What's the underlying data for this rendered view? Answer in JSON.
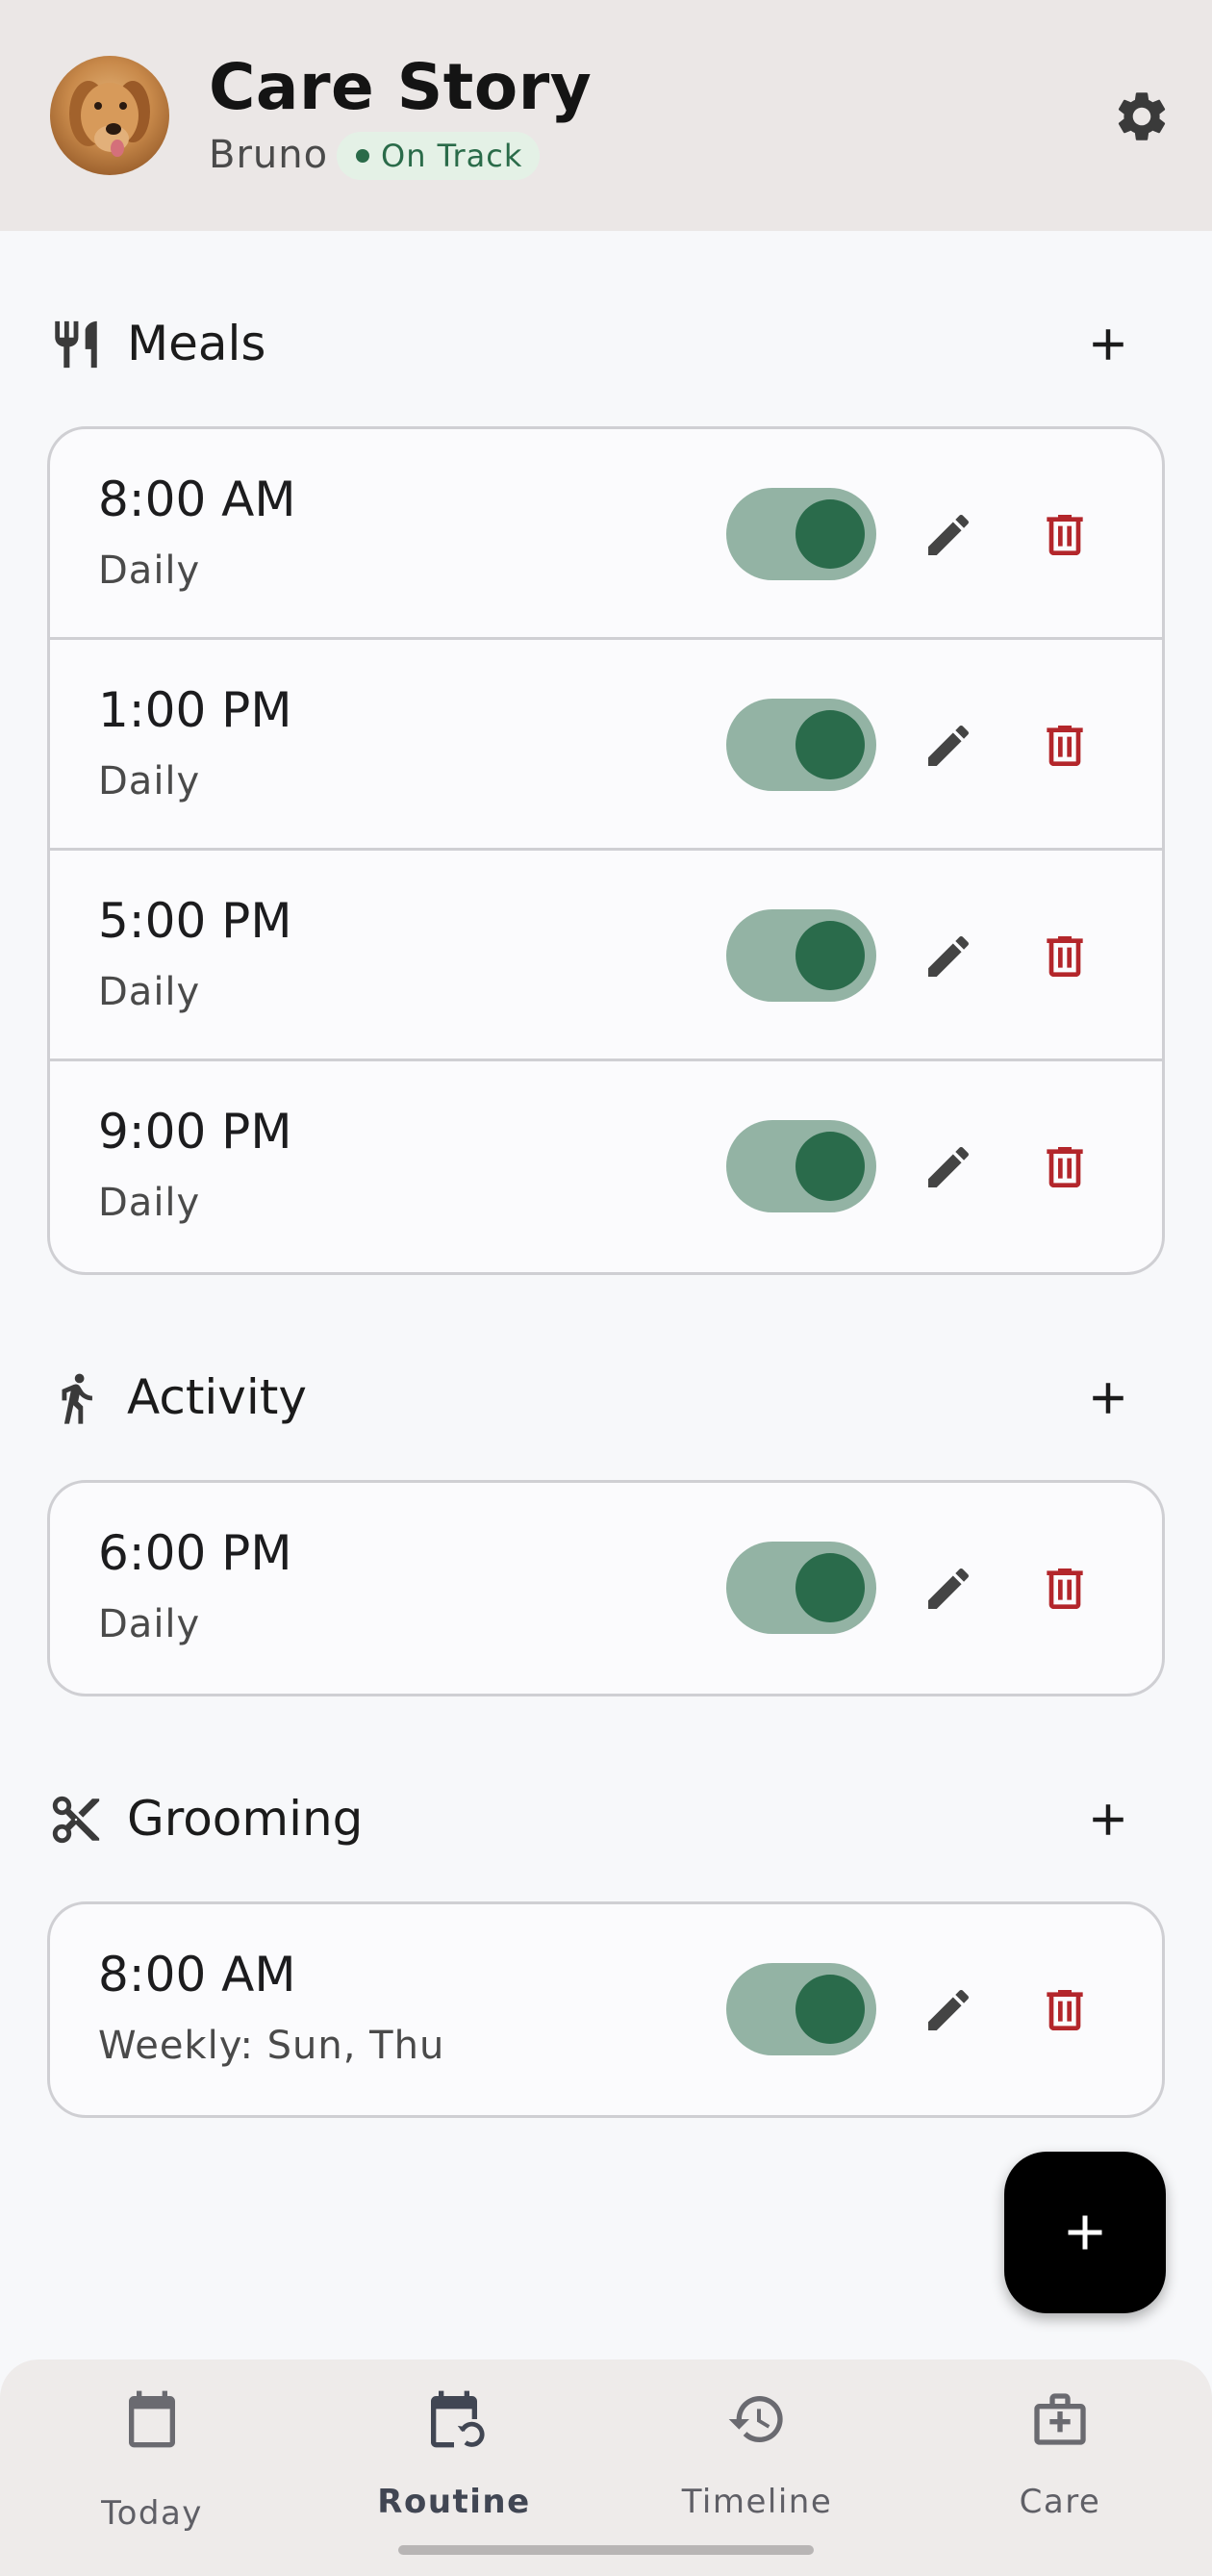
{
  "header": {
    "title": "Care Story",
    "pet_name": "Bruno",
    "status": "On Track",
    "status_color": "#2a6b49",
    "avatar_icon": "dog-photo",
    "settings_icon": "gear-icon"
  },
  "sections": {
    "meals": {
      "title": "Meals",
      "icon": "fork-knife-icon",
      "items": [
        {
          "time": "8:00 AM",
          "frequency": "Daily",
          "enabled": true
        },
        {
          "time": "1:00 PM",
          "frequency": "Daily",
          "enabled": true
        },
        {
          "time": "5:00 PM",
          "frequency": "Daily",
          "enabled": true
        },
        {
          "time": "9:00 PM",
          "frequency": "Daily",
          "enabled": true
        }
      ]
    },
    "activity": {
      "title": "Activity",
      "icon": "walking-person-icon",
      "items": [
        {
          "time": "6:00 PM",
          "frequency": "Daily",
          "enabled": true
        }
      ]
    },
    "grooming": {
      "title": "Grooming",
      "icon": "scissors-icon",
      "items": [
        {
          "time": "8:00 AM",
          "frequency": "Weekly: Sun, Thu",
          "enabled": true
        }
      ]
    }
  },
  "colors": {
    "toggle_track": "#93b3a4",
    "toggle_knob": "#2a6b4b",
    "delete": "#b3262b",
    "fab": "#000000"
  },
  "nav": {
    "items": [
      {
        "label": "Today",
        "icon": "calendar-icon",
        "active": false
      },
      {
        "label": "Routine",
        "icon": "calendar-repeat-icon",
        "active": true
      },
      {
        "label": "Timeline",
        "icon": "history-icon",
        "active": false
      },
      {
        "label": "Care",
        "icon": "medical-bag-icon",
        "active": false
      }
    ]
  }
}
